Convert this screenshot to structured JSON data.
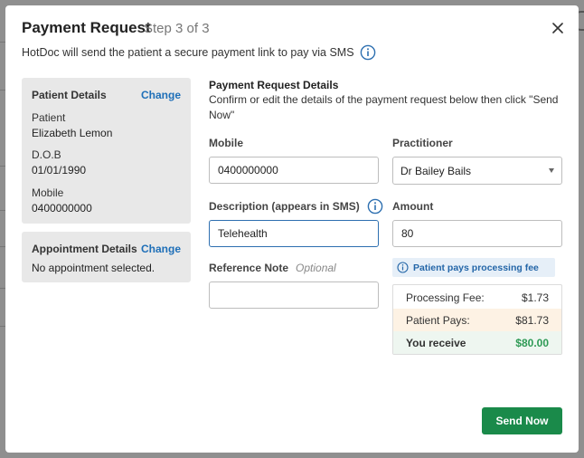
{
  "header": {
    "title": "Payment Request",
    "step": "Step 3 of 3",
    "subtitle": "HotDoc will send the patient a secure payment link to pay via SMS"
  },
  "patient_details": {
    "heading": "Patient Details",
    "change_label": "Change",
    "patient_label": "Patient",
    "patient_value": "Elizabeth Lemon",
    "dob_label": "D.O.B",
    "dob_value": "01/01/1990",
    "mobile_label": "Mobile",
    "mobile_value": "0400000000"
  },
  "appointment_details": {
    "heading": "Appointment Details",
    "change_label": "Change",
    "value": "No appointment selected."
  },
  "form": {
    "section_title": "Payment Request Details",
    "section_desc": "Confirm or edit the details of the payment request below then click \"Send Now\"",
    "mobile_label": "Mobile",
    "mobile_value": "0400000000",
    "practitioner_label": "Practitioner",
    "practitioner_value": "Dr Bailey Bails",
    "description_label": "Description (appears in SMS)",
    "description_value": "Telehealth",
    "amount_label": "Amount",
    "amount_value": "80",
    "reference_label": "Reference Note",
    "reference_optional": "Optional",
    "reference_value": ""
  },
  "fees": {
    "badge_text": "Patient pays processing fee",
    "processing_label": "Processing Fee:",
    "processing_value": "$1.73",
    "patient_pays_label": "Patient Pays:",
    "patient_pays_value": "$81.73",
    "you_receive_label": "You receive",
    "you_receive_value": "$80.00"
  },
  "actions": {
    "send_label": "Send Now"
  },
  "colors": {
    "accent_blue": "#1e6fb8",
    "send_green": "#1a8a4a",
    "receive_green": "#2e9a55"
  }
}
